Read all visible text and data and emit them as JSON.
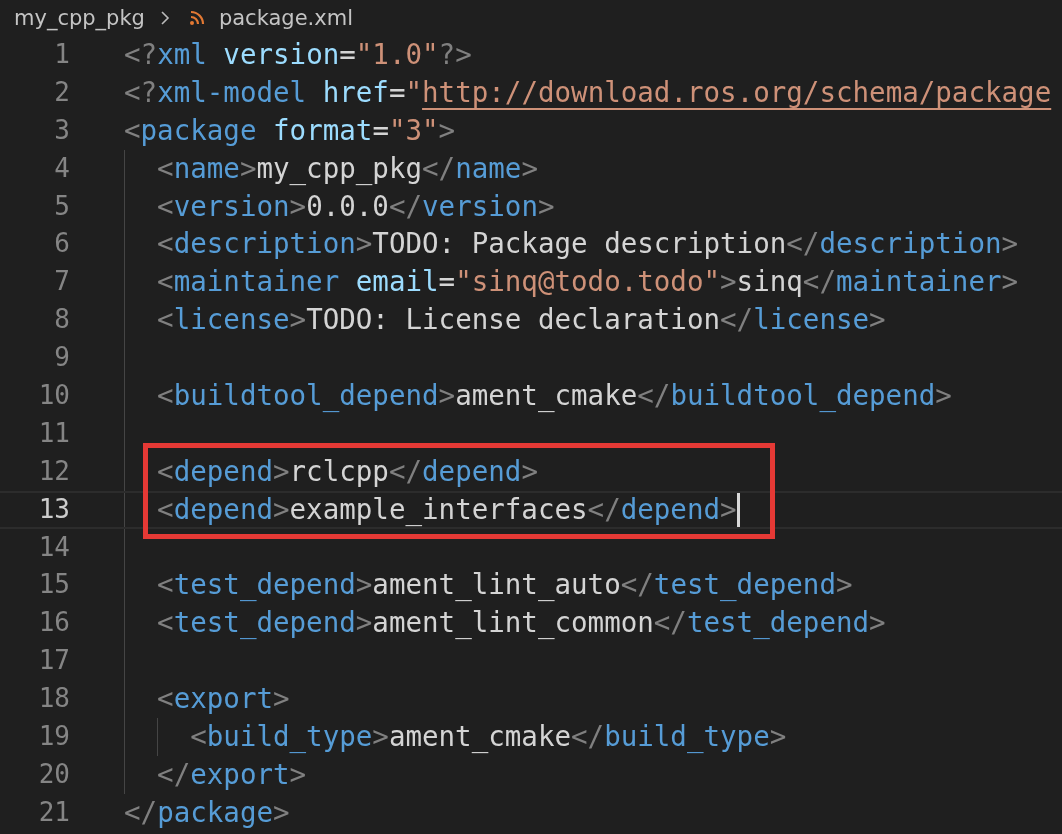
{
  "breadcrumb": [
    {
      "label": "my_cpp_pkg",
      "kind": "folder"
    },
    {
      "label": "package.xml",
      "kind": "xml-file"
    }
  ],
  "lines": [
    {
      "number": "1",
      "tokens": [
        {
          "kind": "punct",
          "text": "<?"
        },
        {
          "kind": "tag",
          "text": "xml"
        },
        {
          "kind": "attr",
          "text": " version"
        },
        {
          "kind": "op",
          "text": "="
        },
        {
          "kind": "string",
          "text": "\"1.0\""
        },
        {
          "kind": "punct",
          "text": "?>"
        }
      ]
    },
    {
      "number": "2",
      "tokens": [
        {
          "kind": "punct",
          "text": "<?"
        },
        {
          "kind": "tag",
          "text": "xml-model"
        },
        {
          "kind": "attr",
          "text": " href"
        },
        {
          "kind": "op",
          "text": "="
        },
        {
          "kind": "string",
          "text": "\""
        },
        {
          "kind": "link",
          "text": "http://download.ros.org/schema/package"
        }
      ]
    },
    {
      "number": "3",
      "tokens": [
        {
          "kind": "punct",
          "text": "<"
        },
        {
          "kind": "tag",
          "text": "package"
        },
        {
          "kind": "attr",
          "text": " format"
        },
        {
          "kind": "op",
          "text": "="
        },
        {
          "kind": "string",
          "text": "\"3\""
        },
        {
          "kind": "punct",
          "text": ">"
        }
      ],
      "children": [
        {
          "number": "4",
          "tokens": [
            {
              "kind": "punct",
              "text": "<"
            },
            {
              "kind": "tag",
              "text": "name"
            },
            {
              "kind": "punct",
              "text": ">"
            },
            {
              "kind": "text",
              "text": "my_cpp_pkg"
            },
            {
              "kind": "punct",
              "text": "</"
            },
            {
              "kind": "tag",
              "text": "name"
            },
            {
              "kind": "punct",
              "text": ">"
            }
          ]
        },
        {
          "number": "5",
          "tokens": [
            {
              "kind": "punct",
              "text": "<"
            },
            {
              "kind": "tag",
              "text": "version"
            },
            {
              "kind": "punct",
              "text": ">"
            },
            {
              "kind": "text",
              "text": "0.0.0"
            },
            {
              "kind": "punct",
              "text": "</"
            },
            {
              "kind": "tag",
              "text": "version"
            },
            {
              "kind": "punct",
              "text": ">"
            }
          ]
        },
        {
          "number": "6",
          "tokens": [
            {
              "kind": "punct",
              "text": "<"
            },
            {
              "kind": "tag",
              "text": "description"
            },
            {
              "kind": "punct",
              "text": ">"
            },
            {
              "kind": "text",
              "text": "TODO: Package description"
            },
            {
              "kind": "punct",
              "text": "</"
            },
            {
              "kind": "tag",
              "text": "description"
            },
            {
              "kind": "punct",
              "text": ">"
            }
          ]
        },
        {
          "number": "7",
          "tokens": [
            {
              "kind": "punct",
              "text": "<"
            },
            {
              "kind": "tag",
              "text": "maintainer"
            },
            {
              "kind": "attr",
              "text": " email"
            },
            {
              "kind": "op",
              "text": "="
            },
            {
              "kind": "string",
              "text": "\"sinq@todo.todo\""
            },
            {
              "kind": "punct",
              "text": ">"
            },
            {
              "kind": "text",
              "text": "sinq"
            },
            {
              "kind": "punct",
              "text": "</"
            },
            {
              "kind": "tag",
              "text": "maintainer"
            },
            {
              "kind": "punct",
              "text": ">"
            }
          ]
        },
        {
          "number": "8",
          "tokens": [
            {
              "kind": "punct",
              "text": "<"
            },
            {
              "kind": "tag",
              "text": "license"
            },
            {
              "kind": "punct",
              "text": ">"
            },
            {
              "kind": "text",
              "text": "TODO: License declaration"
            },
            {
              "kind": "punct",
              "text": "</"
            },
            {
              "kind": "tag",
              "text": "license"
            },
            {
              "kind": "punct",
              "text": ">"
            }
          ]
        },
        {
          "number": "9"
        },
        {
          "number": "10",
          "tokens": [
            {
              "kind": "punct",
              "text": "<"
            },
            {
              "kind": "tag",
              "text": "buildtool_depend"
            },
            {
              "kind": "punct",
              "text": ">"
            },
            {
              "kind": "text",
              "text": "ament_cmake"
            },
            {
              "kind": "punct",
              "text": "</"
            },
            {
              "kind": "tag",
              "text": "buildtool_depend"
            },
            {
              "kind": "punct",
              "text": ">"
            }
          ]
        },
        {
          "number": "11"
        },
        {
          "number": "12",
          "highlighted": true,
          "tokens": [
            {
              "kind": "punct",
              "text": "<"
            },
            {
              "kind": "tag",
              "text": "depend"
            },
            {
              "kind": "punct",
              "text": ">"
            },
            {
              "kind": "text",
              "text": "rclcpp"
            },
            {
              "kind": "punct",
              "text": "</"
            },
            {
              "kind": "tag",
              "text": "depend"
            },
            {
              "kind": "punct",
              "text": ">"
            }
          ]
        },
        {
          "number": "13",
          "highlighted": true,
          "current": true,
          "cursor": true,
          "tokens": [
            {
              "kind": "punct",
              "text": "<"
            },
            {
              "kind": "tag",
              "text": "depend"
            },
            {
              "kind": "punct",
              "text": ">"
            },
            {
              "kind": "text",
              "text": "example_interfaces"
            },
            {
              "kind": "punct",
              "text": "</"
            },
            {
              "kind": "tag",
              "text": "depend"
            },
            {
              "kind": "punct",
              "text": ">"
            }
          ]
        },
        {
          "number": "14"
        },
        {
          "number": "15",
          "tokens": [
            {
              "kind": "punct",
              "text": "<"
            },
            {
              "kind": "tag",
              "text": "test_depend"
            },
            {
              "kind": "punct",
              "text": ">"
            },
            {
              "kind": "text",
              "text": "ament_lint_auto"
            },
            {
              "kind": "punct",
              "text": "</"
            },
            {
              "kind": "tag",
              "text": "test_depend"
            },
            {
              "kind": "punct",
              "text": ">"
            }
          ]
        },
        {
          "number": "16",
          "tokens": [
            {
              "kind": "punct",
              "text": "<"
            },
            {
              "kind": "tag",
              "text": "test_depend"
            },
            {
              "kind": "punct",
              "text": ">"
            },
            {
              "kind": "text",
              "text": "ament_lint_common"
            },
            {
              "kind": "punct",
              "text": "</"
            },
            {
              "kind": "tag",
              "text": "test_depend"
            },
            {
              "kind": "punct",
              "text": ">"
            }
          ]
        },
        {
          "number": "17"
        },
        {
          "number": "18",
          "tokens": [
            {
              "kind": "punct",
              "text": "<"
            },
            {
              "kind": "tag",
              "text": "export"
            },
            {
              "kind": "punct",
              "text": ">"
            }
          ],
          "children": [
            {
              "number": "19",
              "tokens": [
                {
                  "kind": "punct",
                  "text": "<"
                },
                {
                  "kind": "tag",
                  "text": "build_type"
                },
                {
                  "kind": "punct",
                  "text": ">"
                },
                {
                  "kind": "text",
                  "text": "ament_cmake"
                },
                {
                  "kind": "punct",
                  "text": "</"
                },
                {
                  "kind": "tag",
                  "text": "build_type"
                },
                {
                  "kind": "punct",
                  "text": ">"
                }
              ]
            }
          ]
        },
        {
          "number": "20",
          "tokens": [
            {
              "kind": "punct",
              "text": "</"
            },
            {
              "kind": "tag",
              "text": "export"
            },
            {
              "kind": "punct",
              "text": ">"
            }
          ]
        }
      ]
    },
    {
      "number": "21",
      "tokens": [
        {
          "kind": "punct",
          "text": "</"
        },
        {
          "kind": "tag",
          "text": "package"
        },
        {
          "kind": "punct",
          "text": ">"
        }
      ]
    }
  ]
}
